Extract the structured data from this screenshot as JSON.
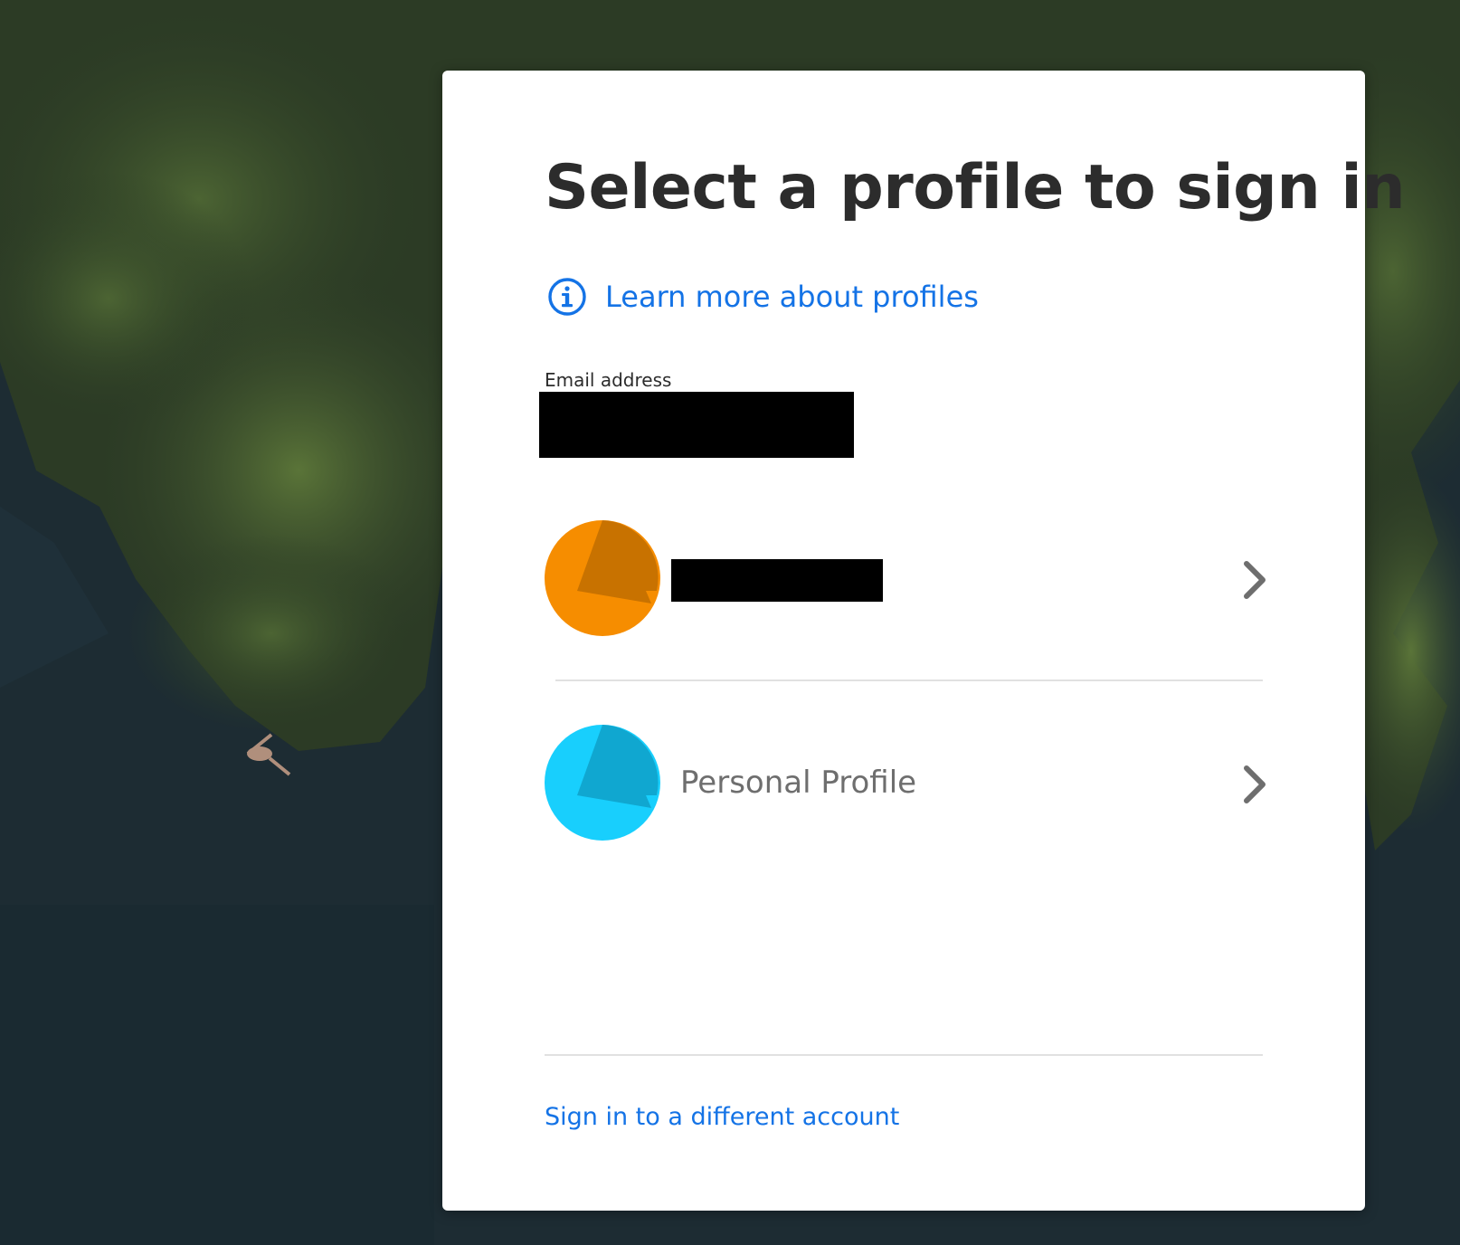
{
  "page": {
    "title": "Select a profile to sign in",
    "learn_more_label": "Learn more about profiles",
    "email_label": "Email address",
    "email_value": "",
    "profiles": [
      {
        "name": "",
        "avatar_color": "#f68d00",
        "avatar_shade": "#c87200",
        "redacted": true
      },
      {
        "name": "Personal Profile",
        "avatar_color": "#18cffd",
        "avatar_shade": "#10a7d0",
        "redacted": false
      }
    ],
    "switch_account_label": "Sign in to a different account"
  },
  "icons": {
    "info": "info-circle-icon",
    "chevron": "chevron-right-icon"
  },
  "colors": {
    "link": "#1473e6",
    "title": "#2c2c2c",
    "profile_text": "#6e6e6e"
  }
}
